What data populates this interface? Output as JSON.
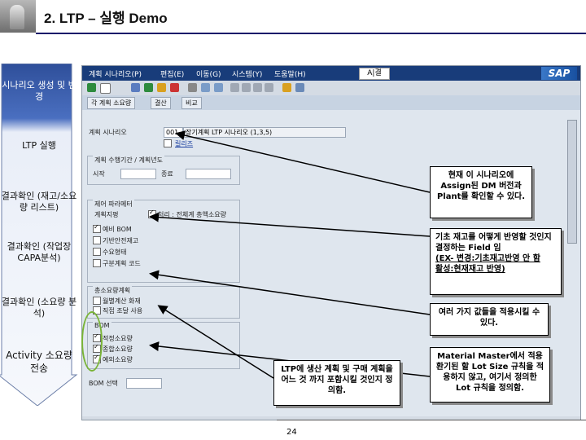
{
  "slide": {
    "title": "2. LTP – 실행 Demo",
    "page_number": "24"
  },
  "process": {
    "steps": [
      "시나리오 생성 및 변경",
      "LTP 실행",
      "결과확인 (재고/소요량 리스트)",
      "결과확인 (작업장 CAPA분석)",
      "결과확인 (소요량 분석)",
      "Activity 소요량 전송"
    ]
  },
  "sap": {
    "menu": [
      "계획 시나리오(P)",
      "편집(E)",
      "이동(G)",
      "시스템(Y)",
      "도움말(H)"
    ],
    "ptext": "A|결",
    "brand": "SAP",
    "app_buttons": [
      "각 계획 소요량",
      "결산",
      "비교"
    ],
    "scenario_label": "계획 시나리오",
    "scenario_code": "001",
    "scenario_value": "장기계획 LTP 시나리오 (1,3,5)",
    "scenario_note": "릴리즈",
    "group_period": "계획 수행기간 / 계획년도",
    "from_label": "시작",
    "to_label": "종료",
    "group_control": "제어 파라메터",
    "control_rows": [
      "계획지평",
      "처리 : 전체계 총액소요량",
      "예비 BOM",
      "기반안전재고",
      "수요형태",
      "구분계획 코드"
    ],
    "group_reqs": "총소요량계획",
    "reqs_rows": [
      "월별계산 화재",
      "직접 조달 사용"
    ],
    "group_bom": "BOM",
    "bom_rows": [
      "적정소요량",
      "종합소요량",
      "예외소요량"
    ],
    "bom_label": "BOM 선택"
  },
  "callouts": {
    "c1": "현재 이 시나리오에 Assign된 DM 버전과 Plant를 확인할 수 있다.",
    "c2": [
      "기초 재고를 어떻게 반영할 것인지 결정하는 Field 임",
      "(EX- 변경:기초재고반영 안 함",
      "활성:현재재고 반영)"
    ],
    "c3": "여러 가지 값들을 적용시킬 수 있다.",
    "c4": "LTP에 생산 계획 및 구매 계획을 어느 것 까지 포함시킬 것인지 정의함.",
    "c5": "Material Master에서 적용 환기된 할 Lot Size 규칙을 적용하지 않고, 여기서 정의한 Lot 규칙을 정의함."
  },
  "colors": {
    "menubar": "#183c7a",
    "arrow": "#3d5fa8",
    "oval": "#7ab437"
  }
}
